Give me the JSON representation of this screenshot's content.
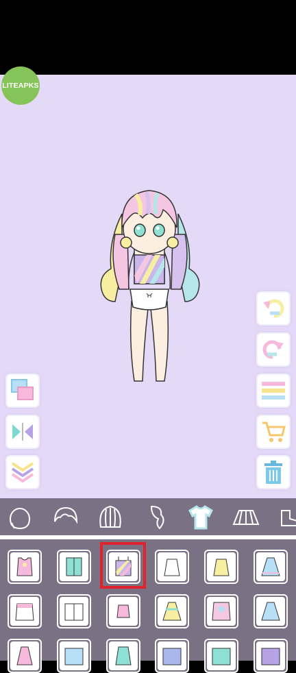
{
  "watermark": {
    "label": "LITEAPKS"
  },
  "colors": {
    "stage_bg": "#e4d9f7",
    "panel_bg": "#7a7185",
    "selection": "#e0242e"
  },
  "left_tools": [
    {
      "name": "layers-button",
      "icon": "layers-icon"
    },
    {
      "name": "flip-button",
      "icon": "flip-horizontal-icon"
    },
    {
      "name": "collapse-button",
      "icon": "chevrons-down-icon"
    }
  ],
  "right_tools": [
    {
      "name": "undo-button",
      "icon": "undo-icon"
    },
    {
      "name": "redo-button",
      "icon": "redo-icon"
    },
    {
      "name": "menu-button",
      "icon": "menu-lines-icon"
    },
    {
      "name": "shop-button",
      "icon": "shopping-cart-icon"
    },
    {
      "name": "trash-button",
      "icon": "trash-icon"
    }
  ],
  "categories": [
    {
      "name": "face-tab",
      "icon": "face-icon",
      "active": false
    },
    {
      "name": "hair-front-tab",
      "icon": "hair-front-icon",
      "active": false
    },
    {
      "name": "hair-back-tab",
      "icon": "hair-back-icon",
      "active": false
    },
    {
      "name": "ponytail-tab",
      "icon": "ponytail-icon",
      "active": false
    },
    {
      "name": "tops-tab",
      "icon": "shirt-icon",
      "active": true
    },
    {
      "name": "skirts-tab",
      "icon": "skirt-icon",
      "active": false
    },
    {
      "name": "shoes-tab",
      "icon": "shoe-icon",
      "active": false
    }
  ],
  "selected_item": "rainbow-stripe-top",
  "items_row1": [
    "pink-love-tank",
    "mint-shirt",
    "rainbow-stripe-top",
    "white-camisole",
    "yellow-camisole",
    "blue-ruffle-dress"
  ],
  "items_row2": [
    "pink-ruffle-top",
    "white-blouse",
    "pink-camisole",
    "yellow-bow-dress",
    "heart-pinafore",
    "blue-frill-dress"
  ],
  "items_row3": [
    "pink-dress-partial",
    "blue-shirt-partial",
    "mint-dress-partial",
    "sailor-partial",
    "mint-tee-partial",
    "purple-tee-partial"
  ]
}
